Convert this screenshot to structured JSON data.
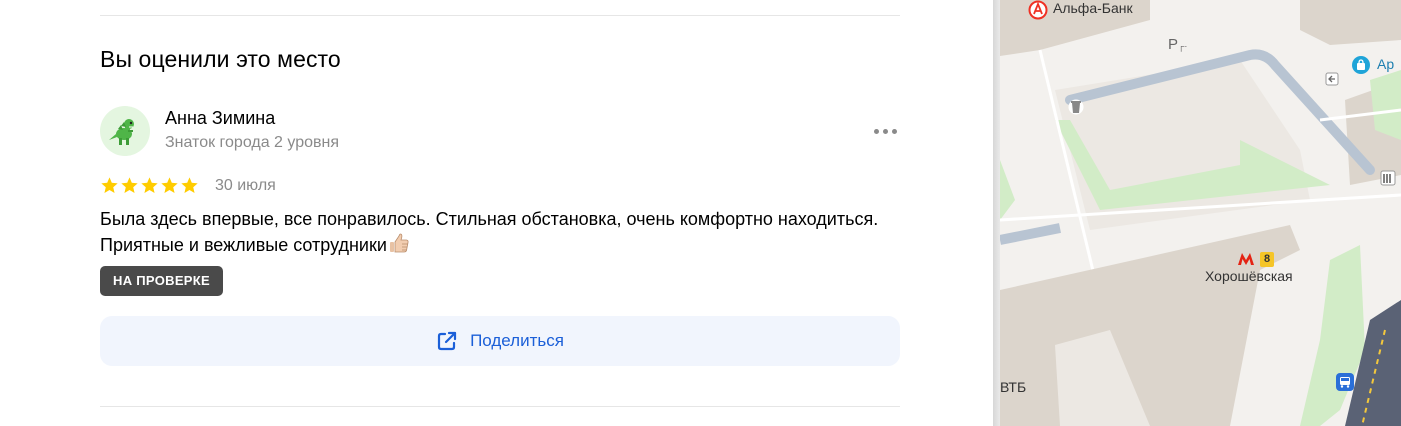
{
  "review_section": {
    "title": "Вы оценили это место",
    "author": {
      "name": "Анна Зимина",
      "level": "Знаток города 2 уровня"
    },
    "rating": 5,
    "rating_max": 5,
    "date": "30 июля",
    "text": "Была здесь впервые, все понравилось. Стильная обстановка, очень комфортно находиться. Приятные и вежливые сотрудники",
    "status_badge": "НА ПРОВЕРКЕ",
    "share_label": "Поделиться",
    "colors": {
      "star": "#ffcc00",
      "badge_bg": "#4a4a4a",
      "share_bg": "#f1f5fd",
      "link": "#1b5fd8"
    }
  },
  "map": {
    "labels": {
      "bank_alfa": "Альфа-Банк",
      "parking": "Р",
      "shop": "Ар",
      "metro_station": "Хорошёвская",
      "metro_line": "8",
      "bank_vtb": "ВТБ"
    },
    "icons": [
      "alfa-bank-icon",
      "parking-icon",
      "shop-icon",
      "entrance-icon",
      "trash-icon",
      "metro-icon",
      "barrier-icon",
      "bus-stop-icon"
    ]
  }
}
